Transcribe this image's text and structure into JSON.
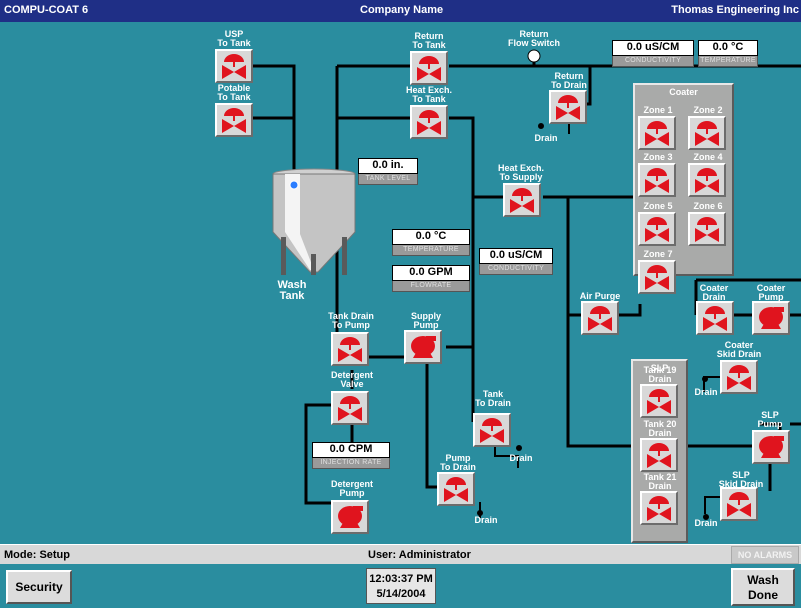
{
  "titlebar": {
    "app": "COMPU-COAT 6",
    "company": "Company Name",
    "vendor": "Thomas Engineering Inc"
  },
  "labels": {
    "usp_to_tank": "USP\nTo Tank",
    "potable_to_tank": "Potable\nTo Tank",
    "return_to_tank": "Return\nTo Tank",
    "heat_exch_to_tank": "Heat Exch.\nTo Tank",
    "return_flow_switch": "Return\nFlow Switch",
    "return_to_drain": "Return\nTo Drain",
    "heat_exch_to_supply": "Heat Exch.\nTo Supply",
    "wash_tank": "Wash\nTank",
    "tank_drain_to_pump": "Tank Drain\nTo Pump",
    "supply_pump": "Supply\nPump",
    "detergent_valve": "Detergent\nValve",
    "detergent_pump": "Detergent\nPump",
    "tank_to_drain": "Tank\nTo Drain",
    "pump_to_drain": "Pump\nTo Drain",
    "air_purge": "Air Purge",
    "coater_drain": "Coater\nDrain",
    "coater_pump": "Coater\nPump",
    "coater_skid_drain": "Coater\nSkid Drain",
    "slp_pump": "SLP\nPump",
    "slp_skid_drain": "SLP\nSkid Drain",
    "drain": "Drain"
  },
  "coater": {
    "title": "Coater",
    "zones": [
      "Zone 1",
      "Zone 2",
      "Zone 3",
      "Zone 4",
      "Zone 5",
      "Zone 6",
      "Zone 7"
    ]
  },
  "slp": {
    "title": "SLP",
    "tanks": [
      "Tank 19\nDrain",
      "Tank 20\nDrain",
      "Tank 21\nDrain"
    ]
  },
  "readouts": {
    "conductivity_top": {
      "value": "0.0 uS/CM",
      "caption": "CONDUCTIVITY"
    },
    "temperature_top": {
      "value": "0.0 °C",
      "caption": "TEMPERATURE"
    },
    "tank_level": {
      "value": "0.0 in.",
      "caption": "TANK LEVEL"
    },
    "temperature": {
      "value": "0.0 °C",
      "caption": "TEMPERATURE"
    },
    "flowrate": {
      "value": "0.0 GPM",
      "caption": "FLOWRATE"
    },
    "conductivity": {
      "value": "0.0 uS/CM",
      "caption": "CONDUCTIVITY"
    },
    "injection_rate": {
      "value": "0.0 CPM",
      "caption": "INJECTION RATE"
    }
  },
  "status": {
    "mode": "Mode: Setup",
    "user": "User: Administrator",
    "alarms": "NO ALARMS"
  },
  "buttons": {
    "security": "Security",
    "wash_done": "Wash\nDone"
  },
  "clock": {
    "time": "12:03:37 PM",
    "date": "5/14/2004"
  },
  "colors": {
    "background": "#2a8d9f",
    "titlebar": "#1f2f86",
    "valve_red": "#e0141e",
    "panel_gray": "#a9aaa9"
  }
}
